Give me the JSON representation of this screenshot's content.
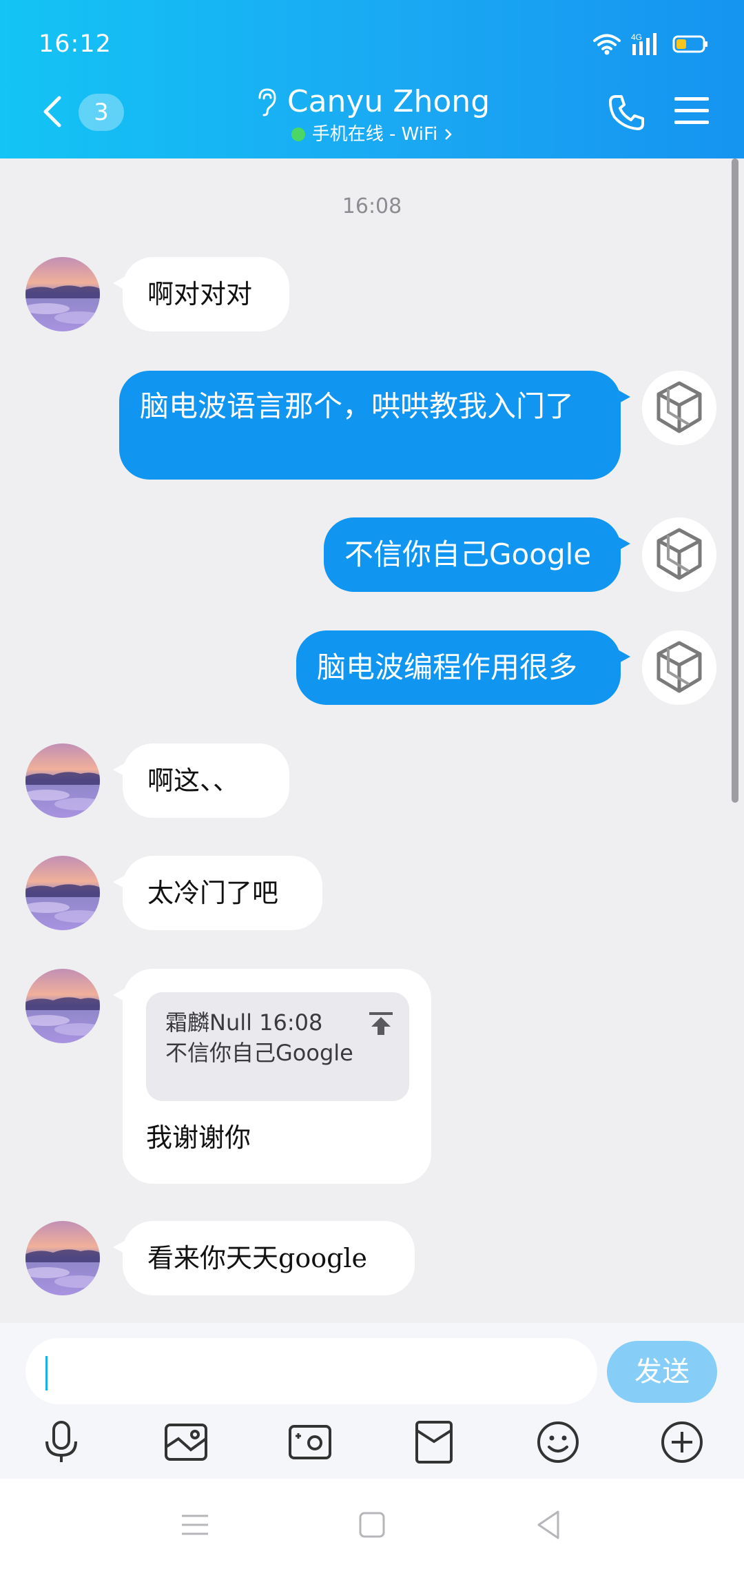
{
  "status_bar": {
    "time": "16:12",
    "network": "4G"
  },
  "header": {
    "unread_count": "3",
    "contact_name": "Canyu Zhong",
    "online_status": "手机在线 - WiFi",
    "accent_color": "#1aa8f3"
  },
  "chat": {
    "timestamp": "16:08",
    "messages": [
      {
        "side": "in",
        "text": "啊对对对"
      },
      {
        "side": "out",
        "text": "脑电波语言那个，哄哄教我入门了"
      },
      {
        "side": "out",
        "text": "不信你自己Google"
      },
      {
        "side": "out",
        "text": "脑电波编程作用很多"
      },
      {
        "side": "in",
        "text": "啊这、、"
      },
      {
        "side": "in",
        "text": "太冷门了吧"
      },
      {
        "side": "in",
        "text": "我谢谢你",
        "quote": {
          "header": "霜麟Null 16:08",
          "text": "不信你自己Google"
        }
      },
      {
        "side": "in",
        "text": "看来你天天google"
      }
    ]
  },
  "input": {
    "value": "",
    "send_label": "发送"
  },
  "toolbar": {
    "icons": [
      "microphone-icon",
      "image-icon",
      "camera-icon",
      "red-packet-icon",
      "emoji-icon",
      "plus-icon"
    ]
  },
  "navbar": {
    "icons": [
      "recent-apps-icon",
      "home-icon",
      "back-triangle-icon"
    ]
  }
}
